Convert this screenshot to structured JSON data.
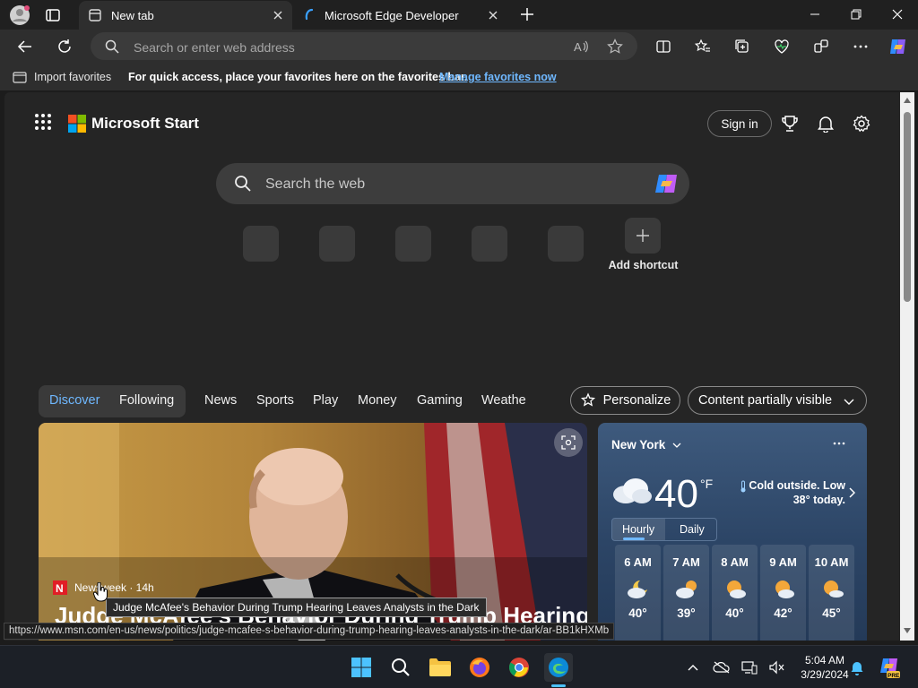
{
  "tabs": [
    {
      "title": "New tab",
      "icon": "newtab-icon",
      "active": true
    },
    {
      "title": "Microsoft Edge Developer",
      "icon": "edge-dev-icon",
      "active": false
    }
  ],
  "toolbar": {
    "address_placeholder": "Search or enter web address"
  },
  "favorites_bar": {
    "import_label": "Import favorites",
    "hint": "For quick access, place your favorites here on the favorites bar.",
    "manage_link": "Manage favorites now"
  },
  "header": {
    "brand": "Microsoft Start",
    "sign_in": "Sign in"
  },
  "web_search": {
    "placeholder": "Search the web"
  },
  "shortcuts": {
    "add_label": "Add shortcut"
  },
  "feed_nav": {
    "items": [
      "Discover",
      "Following",
      "News",
      "Sports",
      "Play",
      "Money",
      "Gaming",
      "Weathe"
    ],
    "active": "Discover",
    "personalize": "Personalize",
    "content_visibility": "Content partially visible"
  },
  "hero": {
    "source": "Newsweek · 14h",
    "headline": "Judge McAfee's Behavior During Trump Hearing"
  },
  "weather": {
    "city": "New York",
    "temperature": "40",
    "unit": "°F",
    "summary": "Cold outside. Low 38° today.",
    "tabs": [
      "Hourly",
      "Daily"
    ],
    "active_tab": "Hourly",
    "hourly": [
      {
        "time": "6 AM",
        "temp": "40°",
        "icon": "partly-cloudy-night-icon"
      },
      {
        "time": "7 AM",
        "temp": "39°",
        "icon": "partly-cloudy-icon"
      },
      {
        "time": "8 AM",
        "temp": "40°",
        "icon": "partly-sunny-icon"
      },
      {
        "time": "9 AM",
        "temp": "42°",
        "icon": "partly-sunny-icon"
      },
      {
        "time": "10 AM",
        "temp": "45°",
        "icon": "partly-sunny-icon"
      }
    ]
  },
  "tooltip": "Judge McAfee's Behavior During Trump Hearing Leaves Analysts in the Dark",
  "status_url": "https://www.msn.com/en-us/news/politics/judge-mcafee-s-behavior-during-trump-hearing-leaves-analysts-in-the-dark/ar-BB1kHXMb",
  "taskbar": {
    "time": "5:04 AM",
    "date": "3/29/2024"
  },
  "colors": {
    "accent": "#6fb8ff",
    "page_bg": "#252525",
    "chrome_bg": "#2e2e2e",
    "weather_bg": "#2c4566"
  }
}
